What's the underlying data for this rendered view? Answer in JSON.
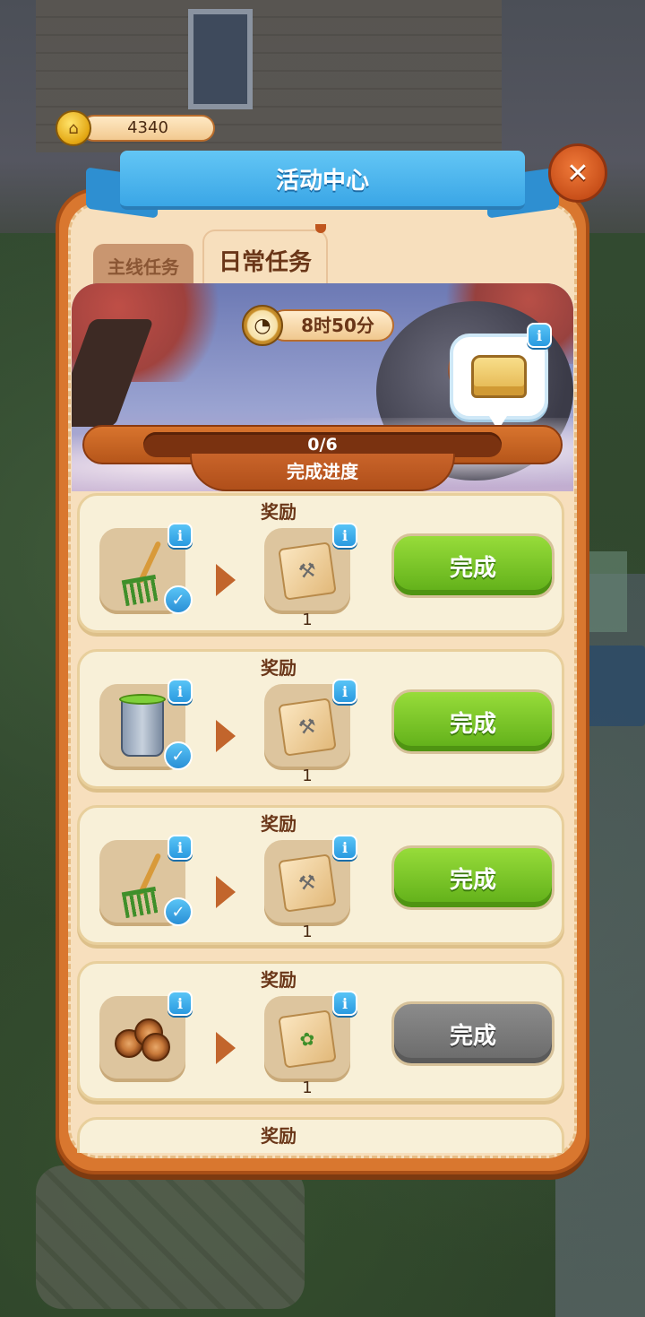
{
  "currency": {
    "amount": "4340",
    "icon": "home-coin-icon"
  },
  "header": {
    "title": "活动中心",
    "close_icon": "close-icon"
  },
  "tabs": [
    {
      "label": "主线任务",
      "active": false
    },
    {
      "label": "日常任务",
      "active": true
    }
  ],
  "banner": {
    "timer_text": "8时50分",
    "timer_icon": "clock-icon",
    "chest_icon": "treasure-chest-icon",
    "info_label": "i"
  },
  "progress": {
    "text": "0/6",
    "current": 0,
    "total": 6,
    "label": "完成进度"
  },
  "tasks": [
    {
      "reward_title": "奖励",
      "item_icon": "rake-icon",
      "item_info": "i",
      "checked": true,
      "reward_icon": "wrench-box-icon",
      "reward_info": "i",
      "reward_qty": "1",
      "button_label": "完成",
      "button_state": "active"
    },
    {
      "reward_title": "奖励",
      "item_icon": "trash-bin-icon",
      "item_info": "i",
      "checked": true,
      "reward_icon": "wrench-box-icon",
      "reward_info": "i",
      "reward_qty": "1",
      "button_label": "完成",
      "button_state": "active"
    },
    {
      "reward_title": "奖励",
      "item_icon": "rake-icon",
      "item_info": "i",
      "checked": true,
      "reward_icon": "wrench-box-icon",
      "reward_info": "i",
      "reward_qty": "1",
      "button_label": "完成",
      "button_state": "active"
    },
    {
      "reward_title": "奖励",
      "item_icon": "firewood-icon",
      "item_info": "i",
      "checked": false,
      "reward_icon": "plant-box-icon",
      "reward_info": "i",
      "reward_qty": "1",
      "button_label": "完成",
      "button_state": "disabled"
    },
    {
      "reward_title": "奖励"
    }
  ],
  "colors": {
    "panel": "#d9772f",
    "ribbon": "#3aa6e6",
    "button_active": "#76c423",
    "button_disabled": "#7a7a7a"
  }
}
